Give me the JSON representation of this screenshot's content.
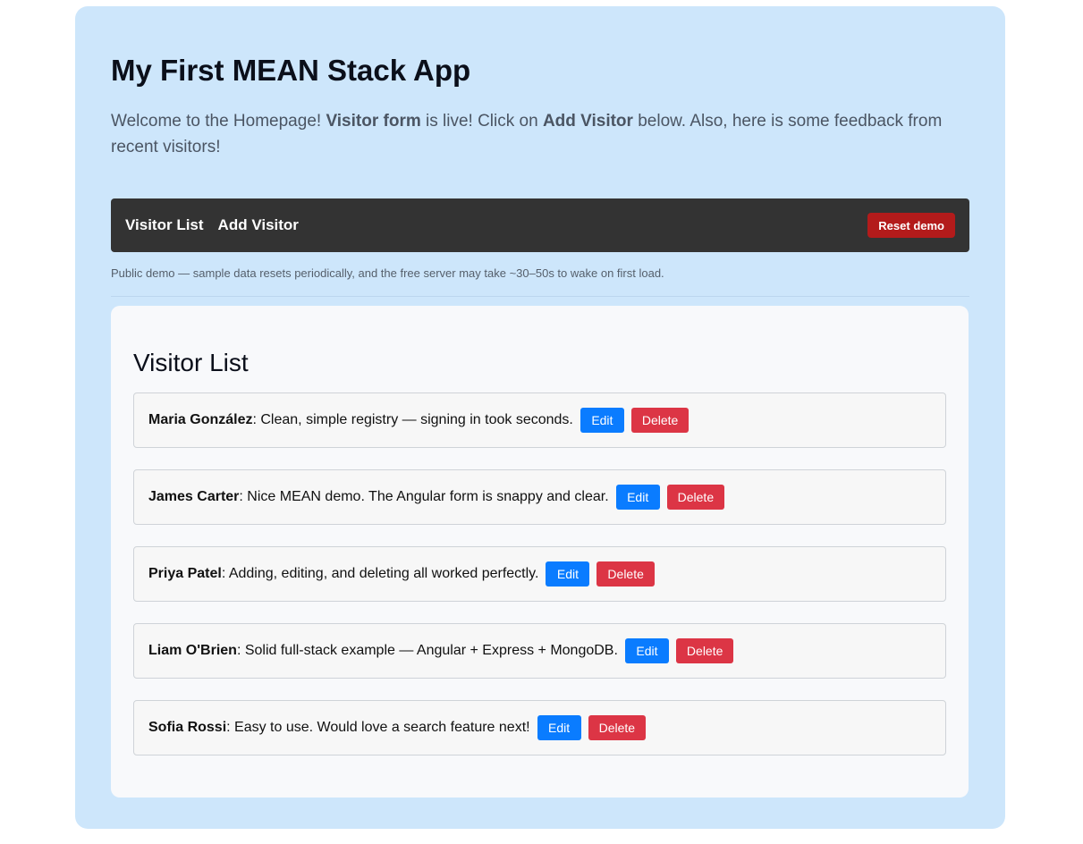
{
  "header": {
    "title": "My First MEAN Stack App",
    "welcome": {
      "part1": "Welcome to the Homepage! ",
      "bold1": "Visitor form",
      "part2": " is live! Click on ",
      "bold2": "Add Visitor",
      "part3": " below. Also, here is some feedback from recent visitors!"
    }
  },
  "nav": {
    "links": [
      "Visitor List",
      "Add Visitor"
    ],
    "reset_label": "Reset demo"
  },
  "demo_note": "Public demo — sample data resets periodically, and the free server may take ~30–50s to wake on first load.",
  "visitor_list": {
    "title": "Visitor List",
    "edit_label": "Edit",
    "delete_label": "Delete",
    "items": [
      {
        "name": "Maria González",
        "message": ": Clean, simple registry — signing in took seconds."
      },
      {
        "name": "James Carter",
        "message": ": Nice MEAN demo. The Angular form is snappy and clear."
      },
      {
        "name": "Priya Patel",
        "message": ": Adding, editing, and deleting all worked perfectly."
      },
      {
        "name": "Liam O'Brien",
        "message": ": Solid full-stack example — Angular + Express + MongoDB."
      },
      {
        "name": "Sofia Rossi",
        "message": ": Easy to use. Would love a search feature next!"
      }
    ]
  },
  "colors": {
    "page_bg": "#cde6fb",
    "navbar_bg": "#333333",
    "reset_btn": "#b31b1b",
    "edit_btn": "#0a7cff",
    "delete_btn": "#dc3545"
  }
}
